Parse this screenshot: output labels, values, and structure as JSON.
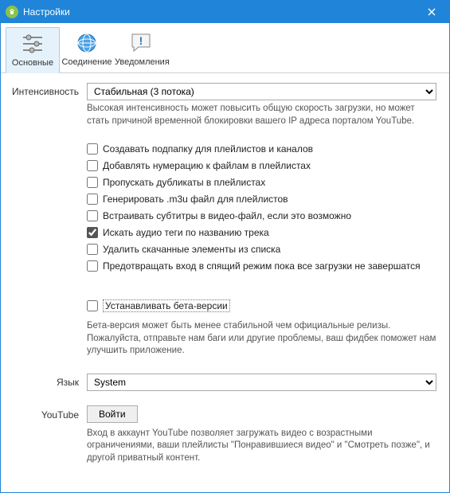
{
  "window": {
    "title": "Настройки"
  },
  "tabs": {
    "basic": "Основные",
    "connection": "Соединение",
    "notifications": "Уведомления"
  },
  "intensity": {
    "label": "Интенсивность",
    "value": "Стабильная (3 потока)",
    "hint": "Высокая интенсивность может повысить общую скорость загрузки, но может стать причиной временной блокировки вашего IP адреса порталом YouTube."
  },
  "options": [
    {
      "label": "Создавать подпапку для плейлистов и каналов",
      "checked": false
    },
    {
      "label": "Добавлять нумерацию к файлам в плейлистах",
      "checked": false
    },
    {
      "label": "Пропускать дубликаты в плейлистах",
      "checked": false
    },
    {
      "label": "Генерировать .m3u файл для плейлистов",
      "checked": false
    },
    {
      "label": "Встраивать субтитры в видео-файл, если это возможно",
      "checked": false
    },
    {
      "label": "Искать аудио теги по названию трека",
      "checked": true
    },
    {
      "label": "Удалить скачанные элементы из списка",
      "checked": false
    },
    {
      "label": "Предотвращать вход в спящий режим пока все загрузки не завершатся",
      "checked": false
    }
  ],
  "beta": {
    "label": "Устанавливать бета-версии",
    "checked": false,
    "hint": "Бета-версия может быть менее стабильной чем официальные релизы.  Пожалуйста, отправьте нам баги или другие проблемы, ваш фидбек поможет нам улучшить приложение."
  },
  "language": {
    "label": "Язык",
    "value": "System"
  },
  "youtube": {
    "label": "YouTube",
    "button": "Войти",
    "hint": "Вход в аккаунт YouTube позволяет загружать видео с возрастными ограничениями, ваши плейлисты \"Понравившиеся видео\" и \"Смотреть позже\", и другой приватный контент."
  }
}
